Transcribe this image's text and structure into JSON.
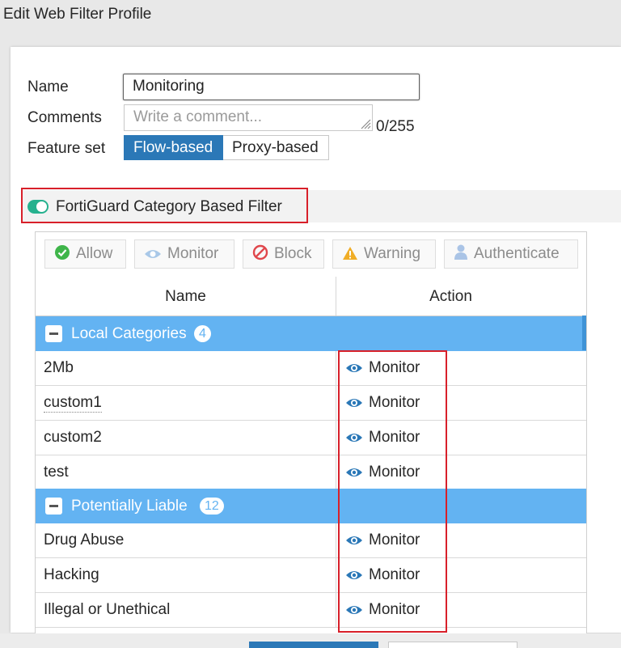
{
  "window": {
    "title": "Edit Web Filter Profile"
  },
  "form": {
    "name_label": "Name",
    "name_value": "Monitoring",
    "comments_label": "Comments",
    "comments_placeholder": "Write a comment...",
    "comments_counter": "0/255",
    "feature_set_label": "Feature set",
    "feature_set_options": [
      "Flow-based",
      "Proxy-based"
    ],
    "feature_set_selected": "Flow-based"
  },
  "section": {
    "title": "FortiGuard Category Based Filter",
    "enabled": true
  },
  "toolbar": {
    "allow": "Allow",
    "monitor": "Monitor",
    "block": "Block",
    "warning": "Warning",
    "authenticate": "Authenticate"
  },
  "table": {
    "columns": [
      "Name",
      "Action"
    ],
    "groups": [
      {
        "name": "Local Categories",
        "count": "4",
        "rows": [
          {
            "name": "2Mb",
            "action": "Monitor"
          },
          {
            "name": "custom1",
            "action": "Monitor"
          },
          {
            "name": "custom2",
            "action": "Monitor"
          },
          {
            "name": "test",
            "action": "Monitor"
          }
        ]
      },
      {
        "name": "Potentially Liable",
        "count": "12",
        "rows": [
          {
            "name": "Drug Abuse",
            "action": "Monitor"
          },
          {
            "name": "Hacking",
            "action": "Monitor"
          },
          {
            "name": "Illegal or Unethical",
            "action": "Monitor"
          }
        ]
      }
    ]
  },
  "icons": {
    "allow": "check-circle-icon",
    "monitor": "eye-icon",
    "block": "ban-icon",
    "warning": "warning-triangle-icon",
    "authenticate": "user-icon",
    "collapse": "minus-square-icon"
  },
  "colors": {
    "primary": "#2b78b7",
    "group_row": "#63b3f2",
    "toggle_on": "#26b18e",
    "highlight": "#d8202a",
    "allow_icon": "#3fb54a",
    "block_icon": "#e0474c",
    "warning_icon": "#f0ad26",
    "eye_icon": "#2b78b7"
  }
}
